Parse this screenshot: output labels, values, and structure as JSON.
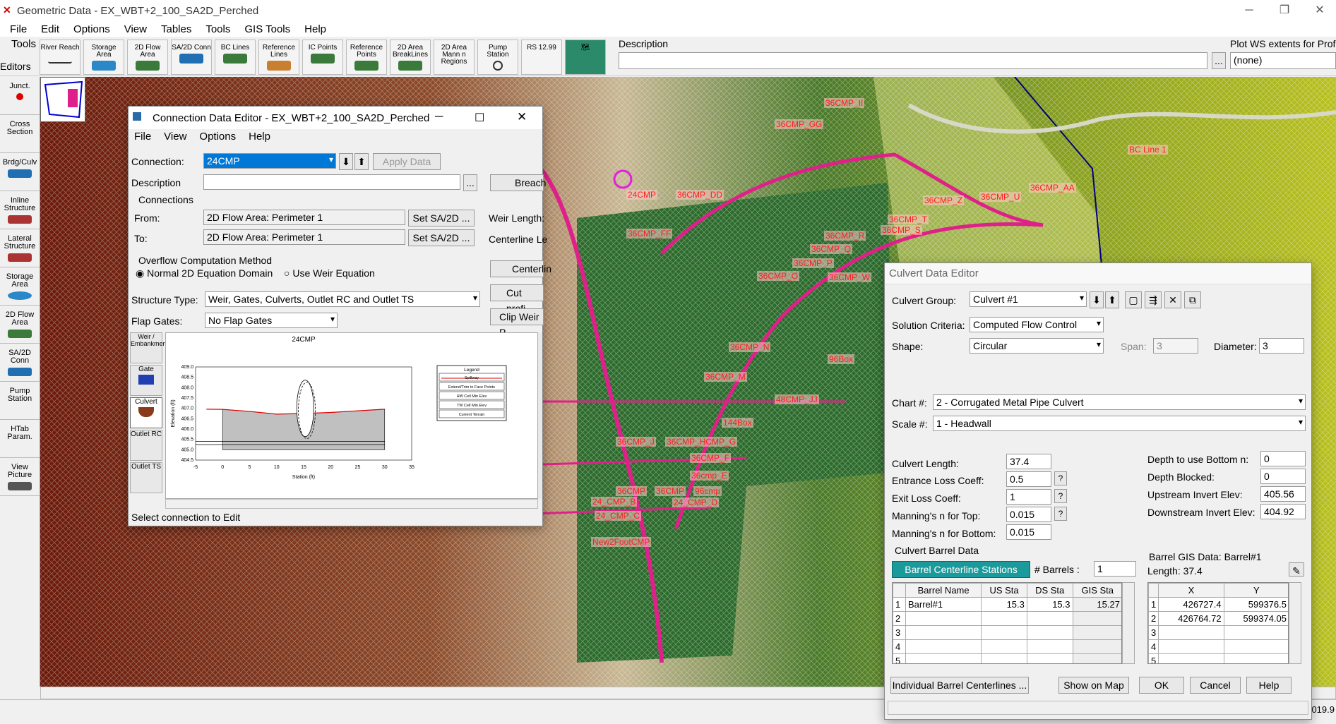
{
  "app": {
    "title": "Geometric Data - EX_WBT+2_100_SA2D_Perched",
    "minimize": "─",
    "maximize": "❐",
    "close": "✕"
  },
  "menu": [
    "File",
    "Edit",
    "Options",
    "View",
    "Tables",
    "Tools",
    "GIS Tools",
    "Help"
  ],
  "toolbar": {
    "tools_label": "Tools",
    "editors_label": "Editors",
    "buttons": [
      "River Reach",
      "Storage Area",
      "2D Flow Area",
      "SA/2D Conn",
      "BC Lines",
      "Reference Lines",
      "IC Points",
      "Reference Points",
      "2D Area BreakLines",
      "2D Area Mann n Regions",
      "Pump Station",
      "RS 12.99"
    ],
    "description_label": "Description",
    "plot_ws_label": "Plot WS extents for Prof",
    "plot_ws_value": "(none)",
    "ellipsis": "..."
  },
  "left_panel": [
    "Junct.",
    "Cross Section",
    "Brdg/Culv",
    "Inline Structure",
    "Lateral Structure",
    "Storage Area",
    "2D Flow Area",
    "SA/2D Conn",
    "Pump Station",
    "HTab Param.",
    "View Picture"
  ],
  "map_labels": [
    "36CMP_II",
    "36CMP_GG",
    "BC Line 1",
    "36CMP_AA",
    "24CMP",
    "36CMP_DD",
    "36CMP_Z",
    "36CMP_U",
    "36CMP_T",
    "36CMP_S",
    "36CMP_FF",
    "36CMP_R",
    "36CMP_Q",
    "36CMP_P",
    "36CMP_O",
    "36CMP_W",
    "36CMP_N",
    "96Box",
    "36CMP_M",
    "48CMP_JJ",
    "144Box",
    "36CMP_J",
    "36CMP_HCMP_G",
    "36CMP_F",
    "36cmp_E",
    "36CMP",
    "36CMP",
    "96cmp",
    "24_CMP_B",
    "24_CMP_D",
    "24_CMP_C",
    "New2FootCMP"
  ],
  "status_right": "019.9",
  "conn": {
    "title": "Connection Data Editor - EX_WBT+2_100_SA2D_Perched",
    "menu": [
      "File",
      "View",
      "Options",
      "Help"
    ],
    "connection_label": "Connection:",
    "connection_value": "24CMP",
    "apply": "Apply Data",
    "description_label": "Description",
    "connections_group": "Connections",
    "from_label": "From:",
    "from_value": "2D Flow Area: Perimeter 1",
    "to_label": "To:",
    "to_value": "2D Flow Area: Perimeter 1",
    "set_btn": "Set SA/2D ...",
    "breach": "Breach",
    "weir_length": "Weir Length:",
    "centerline_len": "Centerline Le",
    "centerline": "Centerlin",
    "cut_profile": "Cut profi",
    "clip_weir": "Clip Weir P",
    "overflow_group": "Overflow Computation Method",
    "opt1": "Normal 2D Equation Domain",
    "opt2": "Use Weir Equation",
    "structure_type_label": "Structure Type:",
    "structure_type": "Weir, Gates, Culverts, Outlet RC and Outlet TS",
    "flap_label": "Flap Gates:",
    "flap_value": "No Flap Gates",
    "side_tabs": [
      "Weir / Embankment",
      "Gate",
      "Culvert",
      "Outlet RC",
      "Outlet TS"
    ],
    "chart_title": "24CMP",
    "xlabel": "Station (ft)",
    "ylabel": "Elevation (ft)",
    "legend_title": "Legend",
    "legend": [
      "Spillway",
      "Extend/Trim to Face Points",
      "HW Cell Min Elev",
      "TW Cell Min Elev",
      "Current Terrain"
    ],
    "status": "Select connection to Edit"
  },
  "chart_data": {
    "type": "line",
    "title": "24CMP",
    "xlabel": "Station (ft)",
    "ylabel": "Elevation (ft)",
    "xlim": [
      -5,
      35
    ],
    "ylim": [
      404.5,
      409.0
    ],
    "xticks": [
      "-5",
      "0",
      "5",
      "10",
      "15",
      "20",
      "25",
      "30",
      "35"
    ],
    "yticks": [
      "409.0",
      "408.5",
      "408.0",
      "407.5",
      "407.0",
      "406.5",
      "406.0",
      "405.5",
      "405.0",
      "404.5"
    ],
    "series": [
      {
        "name": "Spillway",
        "x": [
          -3,
          0,
          5,
          10,
          15,
          20,
          25,
          30
        ],
        "y": [
          406.96,
          406.95,
          406.85,
          406.72,
          406.75,
          406.8,
          406.88,
          406.96
        ]
      },
      {
        "name": "Current Terrain",
        "x": [
          0,
          30
        ],
        "y": [
          405.0,
          405.0
        ]
      }
    ]
  },
  "culv": {
    "title": "Culvert Data Editor",
    "group_label": "Culvert Group:",
    "group_value": "Culvert #1",
    "solution_label": "Solution Criteria:",
    "solution_value": "Computed Flow Control",
    "shape_label": "Shape:",
    "shape_value": "Circular",
    "span_label": "Span:",
    "span_value": "3",
    "diam_label": "Diameter:",
    "diam_value": "3",
    "chart_label": "Chart #:",
    "chart_value": "2 - Corrugated Metal Pipe Culvert",
    "scale_label": "Scale #:",
    "scale_value": "1 - Headwall",
    "length_label": "Culvert Length:",
    "length_value": "37.4",
    "entrance_label": "Entrance Loss Coeff:",
    "entrance_value": "0.5",
    "exit_label": "Exit Loss Coeff:",
    "exit_value": "1",
    "mtop_label": "Manning's n for Top:",
    "mtop_value": "0.015",
    "mbot_label": "Manning's n for Bottom:",
    "mbot_value": "0.015",
    "depthbot_label": "Depth to use Bottom n:",
    "depthbot_value": "0",
    "blocked_label": "Depth Blocked:",
    "blocked_value": "0",
    "usinv_label": "Upstream Invert Elev:",
    "usinv_value": "405.56",
    "dsinv_label": "Downstream Invert Elev:",
    "dsinv_value": "404.92",
    "barrel_group": "Culvert Barrel Data",
    "stations_btn": "Barrel Centerline Stations",
    "nbarrels_label": "# Barrels :",
    "nbarrels_value": "1",
    "cols": [
      "Barrel Name",
      "US Sta",
      "DS Sta",
      "GIS Sta"
    ],
    "rows": [
      [
        "1",
        "Barrel#1",
        "15.3",
        "15.3",
        "15.27"
      ],
      [
        "2",
        "",
        "",
        "",
        ""
      ],
      [
        "3",
        "",
        "",
        "",
        ""
      ],
      [
        "4",
        "",
        "",
        "",
        ""
      ],
      [
        "5",
        "",
        "",
        "",
        ""
      ]
    ],
    "gis_label": "Barrel GIS Data: Barrel#1",
    "gis_length": "Length: 37.4",
    "gis_cols": [
      "X",
      "Y"
    ],
    "gis_rows": [
      [
        "1",
        "426727.4",
        "599376.5"
      ],
      [
        "2",
        "426764.72",
        "599374.05"
      ],
      [
        "3",
        "",
        ""
      ],
      [
        "4",
        "",
        ""
      ],
      [
        "5",
        "",
        ""
      ]
    ],
    "individual": "Individual Barrel Centerlines ...",
    "show_map": "Show on Map",
    "ok": "OK",
    "cancel": "Cancel",
    "help": "Help",
    "help_q": "?"
  },
  "colors": {
    "selected": "#0078d7",
    "culvert_tab": "#1a9a9a",
    "road": "#e0208a",
    "map_dark": "#2d6b2d",
    "map_brown": "#7a2a10"
  }
}
